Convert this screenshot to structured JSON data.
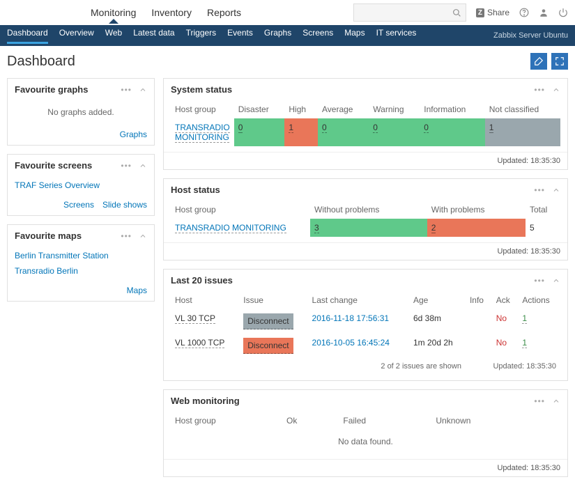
{
  "topnav": {
    "menu": [
      "Monitoring",
      "Inventory",
      "Reports"
    ],
    "share_label": "Share",
    "share_badge": "Z"
  },
  "subnav": {
    "tabs": [
      "Dashboard",
      "Overview",
      "Web",
      "Latest data",
      "Triggers",
      "Events",
      "Graphs",
      "Screens",
      "Maps",
      "IT services"
    ],
    "server": "Zabbix Server Ubuntu"
  },
  "page_title": "Dashboard",
  "left": {
    "fav_graphs": {
      "title": "Favourite graphs",
      "empty": "No graphs added.",
      "links": [
        "Graphs"
      ]
    },
    "fav_screens": {
      "title": "Favourite screens",
      "items": [
        "TRAF Series Overview"
      ],
      "links": [
        "Screens",
        "Slide shows"
      ]
    },
    "fav_maps": {
      "title": "Favourite maps",
      "items": [
        "Berlin Transmitter Station",
        "Transradio Berlin"
      ],
      "links": [
        "Maps"
      ]
    }
  },
  "right": {
    "sysstatus": {
      "title": "System status",
      "cols": [
        "Host group",
        "Disaster",
        "High",
        "Average",
        "Warning",
        "Information",
        "Not classified"
      ],
      "row_group": "TRANSRADIO MONITORING",
      "row": [
        "0",
        "1",
        "0",
        "0",
        "0",
        "1"
      ],
      "updated": "Updated: 18:35:30"
    },
    "hoststatus": {
      "title": "Host status",
      "cols": [
        "Host group",
        "Without problems",
        "With problems",
        "Total"
      ],
      "row_group": "TRANSRADIO MONITORING",
      "row": [
        "3",
        "2",
        "5"
      ],
      "updated": "Updated: 18:35:30"
    },
    "issues": {
      "title": "Last 20 issues",
      "cols": [
        "Host",
        "Issue",
        "Last change",
        "Age",
        "Info",
        "Ack",
        "Actions"
      ],
      "rows": [
        {
          "host": "VL 30 TCP",
          "issue": "Disconnect",
          "issue_class": "cell-grey",
          "last_change": "2016-11-18 17:56:31",
          "age": "6d 38m",
          "info": "",
          "ack": "No",
          "actions": "1"
        },
        {
          "host": "VL 1000 TCP",
          "issue": "Disconnect",
          "issue_class": "cell-orange",
          "last_change": "2016-10-05 16:45:24",
          "age": "1m 20d 2h",
          "info": "",
          "ack": "No",
          "actions": "1"
        }
      ],
      "shown": "2 of 2 issues are shown",
      "updated": "Updated: 18:35:30"
    },
    "webmon": {
      "title": "Web monitoring",
      "cols": [
        "Host group",
        "Ok",
        "Failed",
        "Unknown"
      ],
      "empty": "No data found.",
      "updated": "Updated: 18:35:30"
    }
  }
}
